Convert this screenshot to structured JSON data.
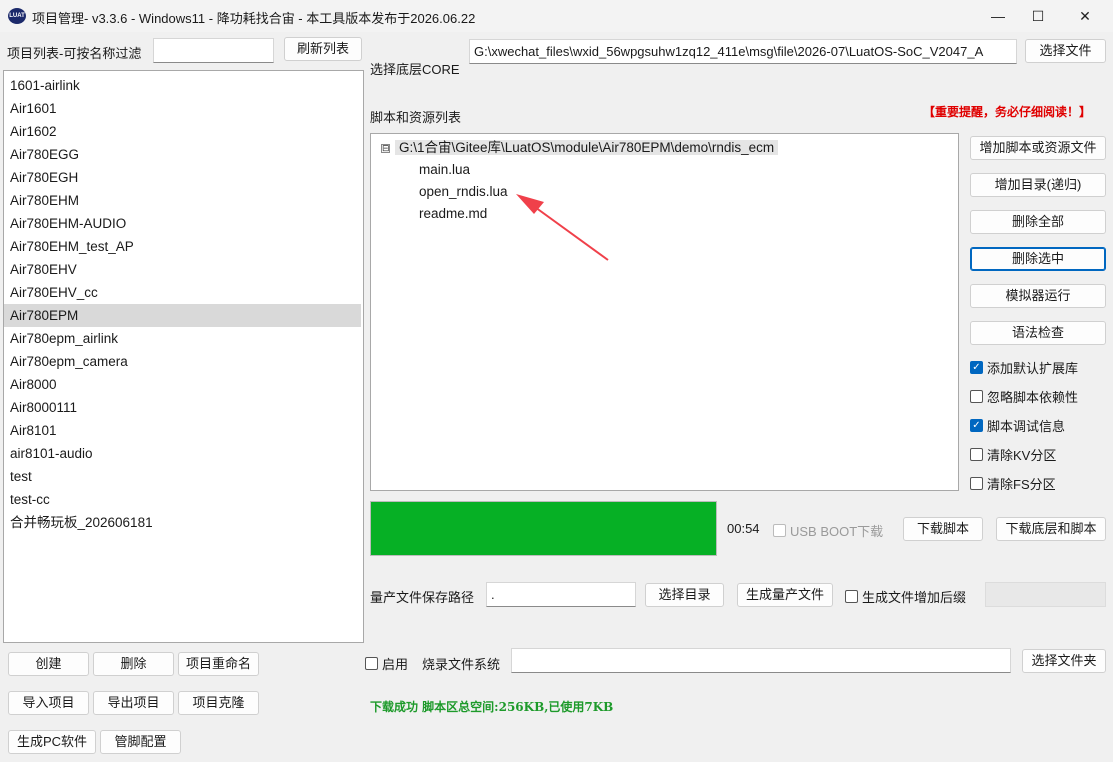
{
  "window": {
    "title": "项目管理- v3.3.6 - Windows11 - 降功耗找合宙 - 本工具版本发布于2026.06.22",
    "icon_text": "LUAT",
    "min_glyph": "—",
    "max_glyph": "☐",
    "close_glyph": "✕"
  },
  "left": {
    "filter_label": "项目列表-可按名称过滤",
    "filter_value": "",
    "refresh_label": "刷新列表",
    "projects": [
      "1601-airlink",
      "Air1601",
      "Air1602",
      "Air780EGG",
      "Air780EGH",
      "Air780EHM",
      "Air780EHM-AUDIO",
      "Air780EHM_test_AP",
      "Air780EHV",
      "Air780EHV_cc",
      "Air780EPM",
      "Air780epm_airlink",
      "Air780epm_camera",
      "Air8000",
      "Air8000111",
      "Air8101",
      "air8101-audio",
      "test",
      "test-cc",
      "合并畅玩板_202606181"
    ],
    "selected": "Air780EPM",
    "buttons": {
      "create": "创建",
      "delete": "删除",
      "rename": "项目重命名",
      "import": "导入项目",
      "export": "导出项目",
      "clone": "项目克隆",
      "gen_pc": "生成PC软件",
      "pin_config": "管脚配置"
    }
  },
  "core": {
    "label": "选择底层CORE",
    "path": "G:\\xwechat_files\\wxid_56wpgsuhw1zq12_411e\\msg\\file\\2026-07\\LuatOS-SoC_V2047_A",
    "select_file": "选择文件"
  },
  "scripts": {
    "label": "脚本和资源列表",
    "warning": "【重要提醒，务必仔细阅读！】",
    "root": "G:\\1合宙\\Gitee库\\LuatOS\\module\\Air780EPM\\demo\\rndis_ecm",
    "expander": "⊟",
    "files": [
      "main.lua",
      "open_rndis.lua",
      "readme.md"
    ]
  },
  "side_buttons": {
    "add_file": "增加脚本或资源文件",
    "add_dir": "增加目录(递归)",
    "delete_all": "删除全部",
    "delete_selected": "删除选中",
    "simulator": "模拟器运行",
    "syntax_check": "语法检查"
  },
  "options": {
    "default_lib": {
      "label": "添加默认扩展库",
      "checked": true
    },
    "ignore_dep": {
      "label": "忽略脚本依赖性",
      "checked": false
    },
    "debug_info": {
      "label": "脚本调试信息",
      "checked": true
    },
    "clear_kv": {
      "label": "清除KV分区",
      "checked": false
    },
    "clear_fs": {
      "label": "清除FS分区",
      "checked": false
    }
  },
  "download": {
    "progress": 1.0,
    "progress_color": "#06b025",
    "time": "00:54",
    "usb_boot": "USB BOOT下载",
    "download_script": "下载脚本",
    "download_all": "下载底层和脚本"
  },
  "mass": {
    "label": "量产文件保存路径",
    "path": ".",
    "select_dir": "选择目录",
    "generate": "生成量产文件",
    "suffix": "生成文件增加后缀"
  },
  "burn": {
    "enable": "启用",
    "label": "烧录文件系统",
    "path": "",
    "select_folder": "选择文件夹"
  },
  "status": "下载成功  脚本区总空间:256KB,已使用7KB"
}
